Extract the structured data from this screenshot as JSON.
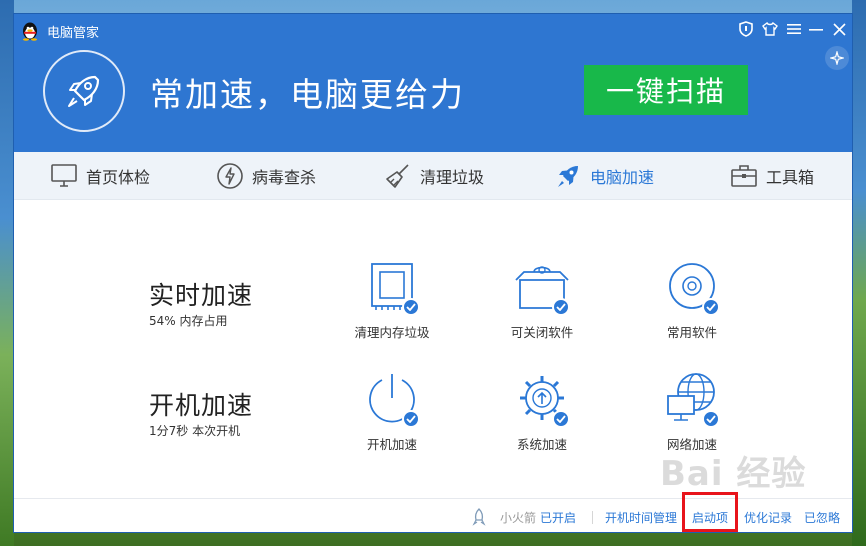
{
  "app": {
    "title": "电脑管家"
  },
  "banner": {
    "headline": "常加速，电脑更给力",
    "scan_button": "一键扫描"
  },
  "tabs": [
    {
      "label": "首页体检",
      "icon": "monitor-icon"
    },
    {
      "label": "病毒查杀",
      "icon": "lightning-shield-icon"
    },
    {
      "label": "清理垃圾",
      "icon": "broom-icon"
    },
    {
      "label": "电脑加速",
      "icon": "rocket-icon",
      "active": true
    },
    {
      "label": "工具箱",
      "icon": "toolbox-icon"
    }
  ],
  "realtime": {
    "title": "实时加速",
    "subtitle": "54% 内存占用",
    "items": [
      {
        "label": "清理内存垃圾",
        "icon": "memory-chip-icon"
      },
      {
        "label": "可关闭软件",
        "icon": "software-box-icon"
      },
      {
        "label": "常用软件",
        "icon": "disc-icon"
      }
    ]
  },
  "boot": {
    "title": "开机加速",
    "subtitle": "1分7秒 本次开机",
    "items": [
      {
        "label": "开机加速",
        "icon": "power-icon"
      },
      {
        "label": "系统加速",
        "icon": "gear-arrow-icon"
      },
      {
        "label": "网络加速",
        "icon": "globe-monitor-icon"
      }
    ]
  },
  "footer": {
    "rocket_label": "小火箭",
    "rocket_status": "已开启",
    "links": [
      "开机时间管理",
      "启动项",
      "优化记录",
      "已忽略"
    ]
  },
  "watermark": "Bai 经验",
  "colors": {
    "brand": "#2e76d1",
    "scan": "#18b84a",
    "accent": "#2b78d6",
    "highlight": "#e8141b"
  }
}
